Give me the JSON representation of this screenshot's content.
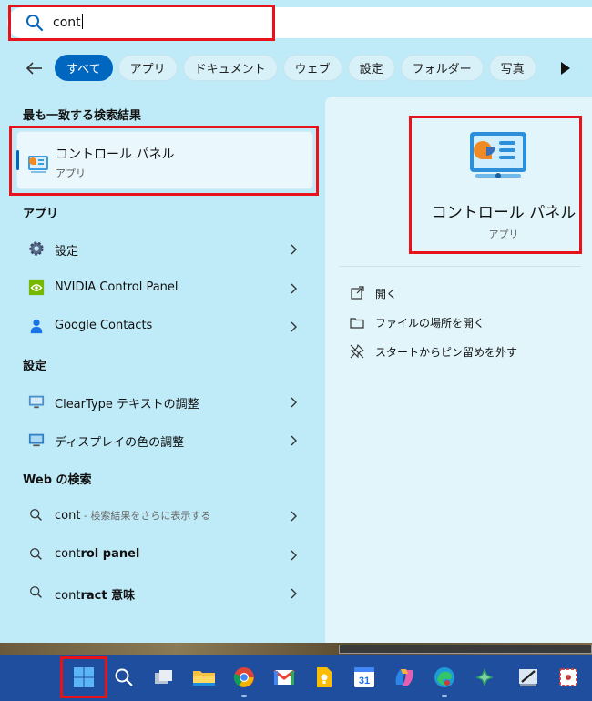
{
  "search": {
    "query": "cont"
  },
  "filters": {
    "items": [
      "すべて",
      "アプリ",
      "ドキュメント",
      "ウェブ",
      "設定",
      "フォルダー",
      "写真"
    ],
    "active_index": 0
  },
  "best_match": {
    "heading": "最も一致する検索結果",
    "title": "コントロール パネル",
    "subtitle": "アプリ"
  },
  "apps": {
    "heading": "アプリ",
    "items": [
      {
        "label": "設定",
        "icon": "gear-icon"
      },
      {
        "label": "NVIDIA Control Panel",
        "icon": "nvidia-icon"
      },
      {
        "label": "Google Contacts",
        "icon": "contacts-icon"
      }
    ]
  },
  "settings": {
    "heading": "設定",
    "items": [
      {
        "label": "ClearType テキストの調整",
        "icon": "monitor-icon"
      },
      {
        "label": "ディスプレイの色の調整",
        "icon": "display-icon"
      }
    ]
  },
  "web": {
    "heading": "Web の検索",
    "items": [
      {
        "prefix": "cont",
        "suffix": " - 検索結果をさらに表示する"
      },
      {
        "prefix": "cont",
        "bold": "rol panel"
      },
      {
        "prefix": "cont",
        "bold": "ract 意味"
      }
    ]
  },
  "detail": {
    "title": "コントロール パネル",
    "subtitle": "アプリ",
    "actions": [
      {
        "label": "開く",
        "icon": "open-external-icon"
      },
      {
        "label": "ファイルの場所を開く",
        "icon": "folder-icon"
      },
      {
        "label": "スタートからピン留めを外す",
        "icon": "unpin-icon"
      }
    ]
  },
  "taskbar": {
    "icons": [
      "start-icon",
      "search-icon",
      "task-view-icon",
      "file-explorer-icon",
      "chrome-icon",
      "gmail-icon",
      "keep-icon",
      "calendar-icon",
      "copilot-icon",
      "edge-icon",
      "app-icon",
      "snipping-icon",
      "screen-recorder-icon"
    ]
  },
  "colors": {
    "accent": "#0067c0",
    "highlight": "#e8121b",
    "taskbar": "#1f4e9e"
  }
}
